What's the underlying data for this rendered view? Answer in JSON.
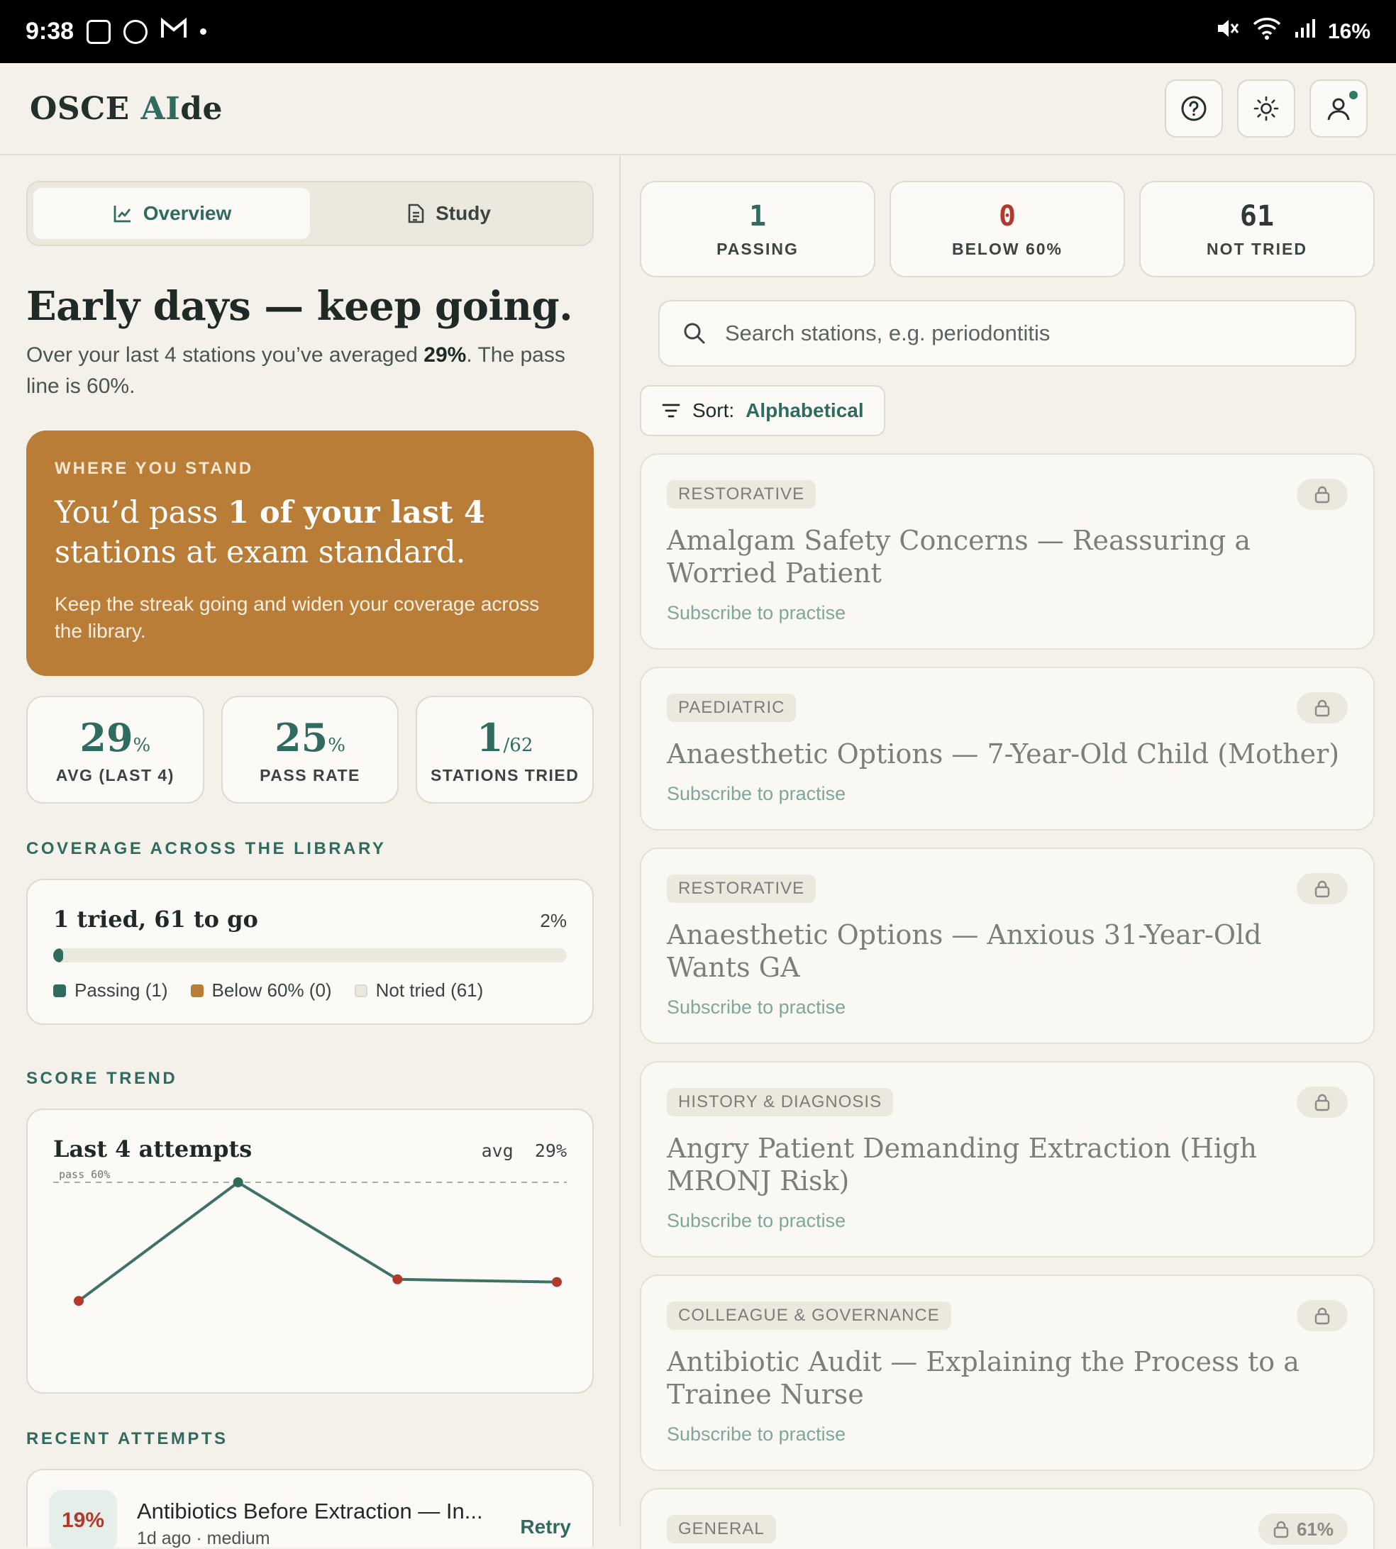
{
  "status_bar": {
    "time": "9:38",
    "battery": "16%"
  },
  "app": {
    "brand_main": "OSCE ",
    "brand_accent": "AI",
    "brand_end": "de"
  },
  "icons": {
    "help": "help-circle-icon",
    "theme": "sun-icon",
    "profile": "user-icon",
    "search": "search-icon",
    "sort": "filter-lines-icon",
    "lock": "lock-icon",
    "overview": "chart-line-icon",
    "study": "document-icon"
  },
  "colors": {
    "brand": "#2f6b5e",
    "amber": "#b97d37",
    "fail": "#b23a2c",
    "background": "#f4f1ea"
  },
  "tabs": [
    {
      "label": "Overview",
      "active": true
    },
    {
      "label": "Study",
      "active": false
    }
  ],
  "summary": {
    "headline": "Early days — keep going.",
    "sub_pre": "Over your last 4 stations you’ve averaged ",
    "sub_bold": "29%",
    "sub_post": ". The pass line is 60%."
  },
  "stand": {
    "eyebrow": "WHERE YOU STAND",
    "title_1": "You’d pass ",
    "title_2": "1 of your last 4",
    "title_3": " stations at exam standard.",
    "body": "Keep the streak going and widen your coverage across the library."
  },
  "stats": [
    {
      "value": "29",
      "suffix": "%",
      "label": "AVG (LAST 4)"
    },
    {
      "value": "25",
      "suffix": "%",
      "label": "PASS RATE"
    },
    {
      "value": "1",
      "suffix": "/62",
      "label": "STATIONS TRIED"
    }
  ],
  "coverage": {
    "section": "COVERAGE ACROSS THE LIBRARY",
    "title": "1 tried, 61 to go",
    "percent": "2%",
    "fill_fraction": 0.02,
    "legend": [
      {
        "label": "Passing (1)",
        "color": "#2f6b5e"
      },
      {
        "label": "Below 60% (0)",
        "color": "#b97d37"
      },
      {
        "label": "Not tried (61)",
        "color": "#ebe8de"
      }
    ]
  },
  "trend": {
    "section": "SCORE TREND",
    "title": "Last 4 attempts",
    "avg_label": "avg",
    "avg_value": "29%",
    "pass_label": "pass 60%",
    "pass_line": 60,
    "scores": [
      16,
      60,
      24,
      23
    ]
  },
  "recent": {
    "section": "RECENT ATTEMPTS",
    "items": [
      {
        "score": "19%",
        "title": "Antibiotics Before Extraction — In...",
        "meta": "1d ago · medium",
        "action": "Retry"
      }
    ]
  },
  "right_stats": [
    {
      "value": "1",
      "label": "PASSING",
      "color": "#2f6b5e"
    },
    {
      "value": "0",
      "label": "BELOW 60%",
      "color": "#b23a2c"
    },
    {
      "value": "61",
      "label": "NOT TRIED",
      "color": "#2f3a36"
    }
  ],
  "search": {
    "placeholder": "Search stations, e.g. periodontitis",
    "value": ""
  },
  "sort": {
    "label": "Sort:",
    "value": "Alphabetical"
  },
  "stations": [
    {
      "tag": "RESTORATIVE",
      "title": "Amalgam Safety Concerns — Reassuring a Worried Patient",
      "cta": "Subscribe to practise",
      "lock_text": ""
    },
    {
      "tag": "PAEDIATRIC",
      "title": "Anaesthetic Options — 7-Year-Old Child (Mother)",
      "cta": "Subscribe to practise",
      "lock_text": ""
    },
    {
      "tag": "RESTORATIVE",
      "title": "Anaesthetic Options — Anxious 31-Year-Old Wants GA",
      "cta": "Subscribe to practise",
      "lock_text": ""
    },
    {
      "tag": "HISTORY & DIAGNOSIS",
      "title": "Angry Patient Demanding Extraction (High MRONJ Risk)",
      "cta": "Subscribe to practise",
      "lock_text": ""
    },
    {
      "tag": "COLLEAGUE & GOVERNANCE",
      "title": "Antibiotic Audit — Explaining the Process to a Trainee Nurse",
      "cta": "Subscribe to practise",
      "lock_text": ""
    },
    {
      "tag": "GENERAL",
      "title": "",
      "cta": "",
      "lock_text": "61%"
    }
  ]
}
